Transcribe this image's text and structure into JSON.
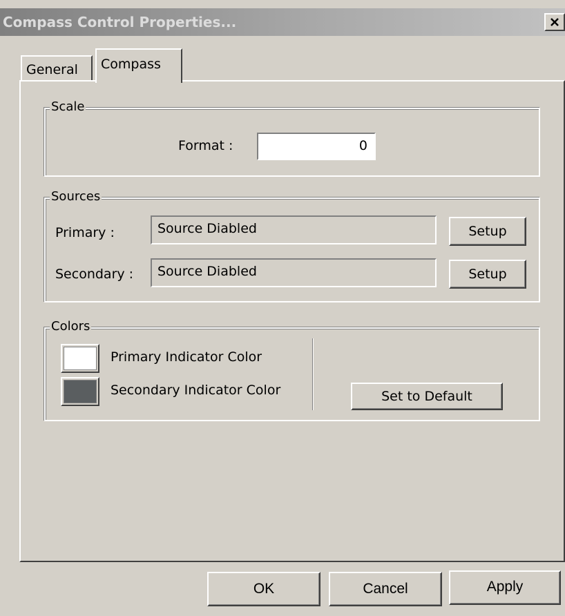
{
  "window": {
    "title": "Compass Control Properties..."
  },
  "tabs": [
    {
      "label": "General"
    },
    {
      "label": "Compass"
    }
  ],
  "scale": {
    "legend": "Scale",
    "format_label": "Format :",
    "format_value": "0"
  },
  "sources": {
    "legend": "Sources",
    "primary_label": "Primary :",
    "primary_value": "Source Diabled",
    "secondary_label": "Secondary :",
    "secondary_value": "Source Diabled",
    "setup_label": "Setup"
  },
  "colors": {
    "legend": "Colors",
    "primary_label": "Primary Indicator Color",
    "primary_color": "#ffffff",
    "secondary_label": "Secondary Indicator Color",
    "secondary_color": "#5a5e60",
    "default_button": "Set to Default"
  },
  "buttons": {
    "ok": "OK",
    "cancel": "Cancel",
    "apply": "Apply"
  }
}
